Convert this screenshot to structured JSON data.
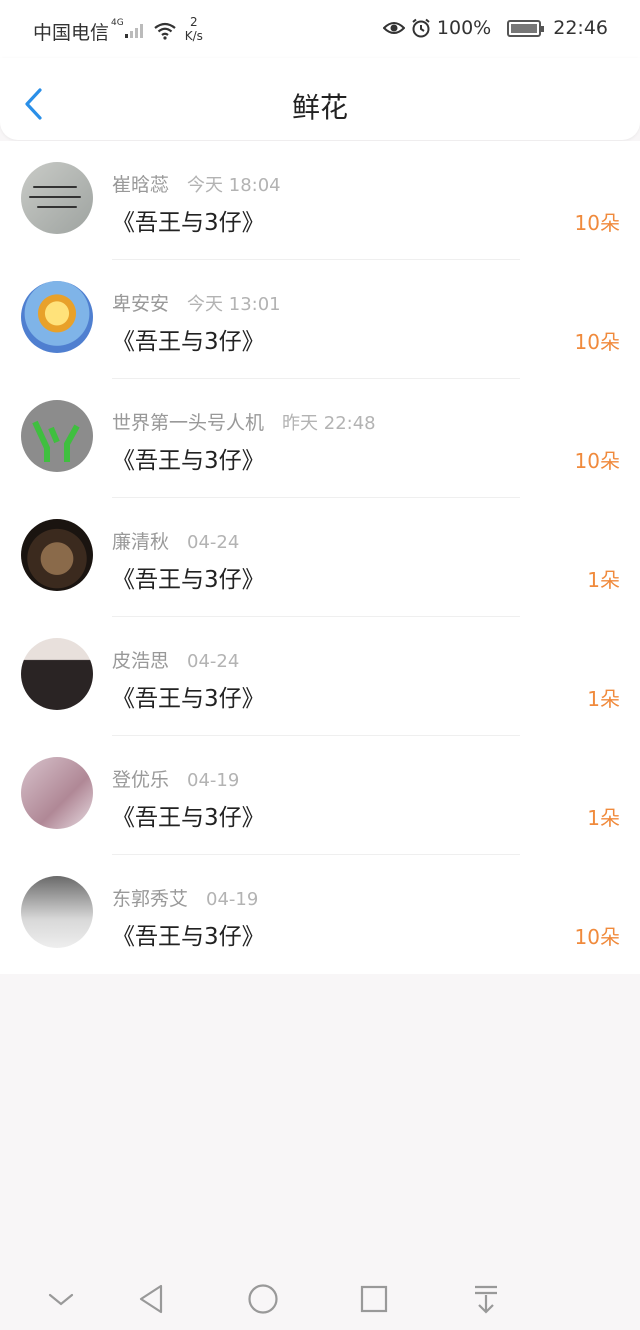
{
  "status_bar": {
    "carrier": "中国电信",
    "network": "4G",
    "speed_value": "2",
    "speed_unit": "K/s",
    "battery": "100%",
    "time": "22:46"
  },
  "header": {
    "title": "鲜花"
  },
  "items": [
    {
      "name": "崔晗蕊",
      "time": "今天 18:04",
      "book": "《吾王与3仔》",
      "amount": "10朵"
    },
    {
      "name": "卑安安",
      "time": "今天 13:01",
      "book": "《吾王与3仔》",
      "amount": "10朵"
    },
    {
      "name": "世界第一头号人机",
      "time": "昨天 22:48",
      "book": "《吾王与3仔》",
      "amount": "10朵"
    },
    {
      "name": "廉清秋",
      "time": "04-24",
      "book": "《吾王与3仔》",
      "amount": "1朵"
    },
    {
      "name": "皮浩思",
      "time": "04-24",
      "book": "《吾王与3仔》",
      "amount": "1朵"
    },
    {
      "name": "登优乐",
      "time": "04-19",
      "book": "《吾王与3仔》",
      "amount": "1朵"
    },
    {
      "name": "东郭秀艾",
      "time": "04-19",
      "book": "《吾王与3仔》",
      "amount": "10朵"
    }
  ],
  "colors": {
    "accent_blue": "#2a8fe8",
    "amount_orange": "#f08a3c"
  }
}
